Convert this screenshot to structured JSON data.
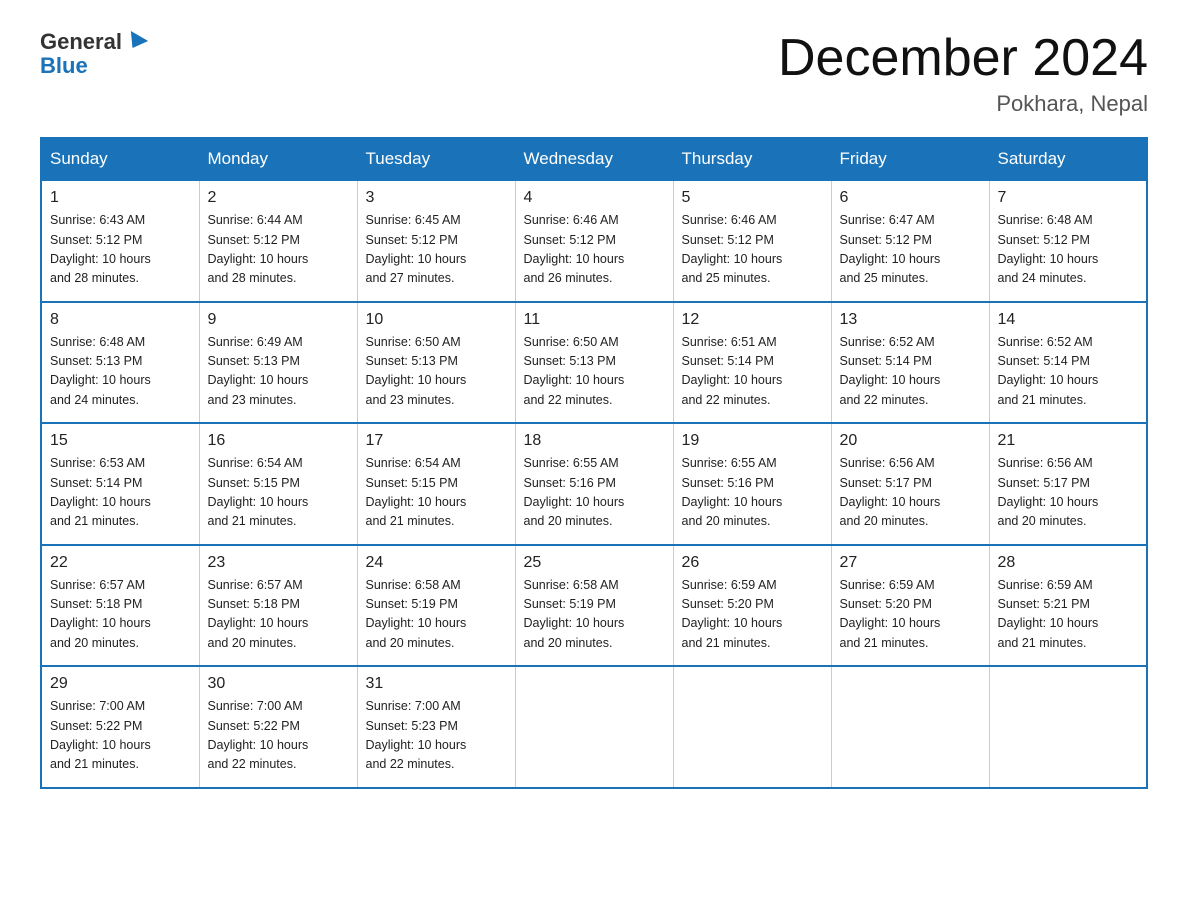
{
  "header": {
    "logo_general": "General",
    "logo_blue": "Blue",
    "month_title": "December 2024",
    "location": "Pokhara, Nepal"
  },
  "days_of_week": [
    "Sunday",
    "Monday",
    "Tuesday",
    "Wednesday",
    "Thursday",
    "Friday",
    "Saturday"
  ],
  "weeks": [
    [
      {
        "num": "1",
        "sunrise": "6:43 AM",
        "sunset": "5:12 PM",
        "daylight": "10 hours and 28 minutes."
      },
      {
        "num": "2",
        "sunrise": "6:44 AM",
        "sunset": "5:12 PM",
        "daylight": "10 hours and 28 minutes."
      },
      {
        "num": "3",
        "sunrise": "6:45 AM",
        "sunset": "5:12 PM",
        "daylight": "10 hours and 27 minutes."
      },
      {
        "num": "4",
        "sunrise": "6:46 AM",
        "sunset": "5:12 PM",
        "daylight": "10 hours and 26 minutes."
      },
      {
        "num": "5",
        "sunrise": "6:46 AM",
        "sunset": "5:12 PM",
        "daylight": "10 hours and 25 minutes."
      },
      {
        "num": "6",
        "sunrise": "6:47 AM",
        "sunset": "5:12 PM",
        "daylight": "10 hours and 25 minutes."
      },
      {
        "num": "7",
        "sunrise": "6:48 AM",
        "sunset": "5:12 PM",
        "daylight": "10 hours and 24 minutes."
      }
    ],
    [
      {
        "num": "8",
        "sunrise": "6:48 AM",
        "sunset": "5:13 PM",
        "daylight": "10 hours and 24 minutes."
      },
      {
        "num": "9",
        "sunrise": "6:49 AM",
        "sunset": "5:13 PM",
        "daylight": "10 hours and 23 minutes."
      },
      {
        "num": "10",
        "sunrise": "6:50 AM",
        "sunset": "5:13 PM",
        "daylight": "10 hours and 23 minutes."
      },
      {
        "num": "11",
        "sunrise": "6:50 AM",
        "sunset": "5:13 PM",
        "daylight": "10 hours and 22 minutes."
      },
      {
        "num": "12",
        "sunrise": "6:51 AM",
        "sunset": "5:14 PM",
        "daylight": "10 hours and 22 minutes."
      },
      {
        "num": "13",
        "sunrise": "6:52 AM",
        "sunset": "5:14 PM",
        "daylight": "10 hours and 22 minutes."
      },
      {
        "num": "14",
        "sunrise": "6:52 AM",
        "sunset": "5:14 PM",
        "daylight": "10 hours and 21 minutes."
      }
    ],
    [
      {
        "num": "15",
        "sunrise": "6:53 AM",
        "sunset": "5:14 PM",
        "daylight": "10 hours and 21 minutes."
      },
      {
        "num": "16",
        "sunrise": "6:54 AM",
        "sunset": "5:15 PM",
        "daylight": "10 hours and 21 minutes."
      },
      {
        "num": "17",
        "sunrise": "6:54 AM",
        "sunset": "5:15 PM",
        "daylight": "10 hours and 21 minutes."
      },
      {
        "num": "18",
        "sunrise": "6:55 AM",
        "sunset": "5:16 PM",
        "daylight": "10 hours and 20 minutes."
      },
      {
        "num": "19",
        "sunrise": "6:55 AM",
        "sunset": "5:16 PM",
        "daylight": "10 hours and 20 minutes."
      },
      {
        "num": "20",
        "sunrise": "6:56 AM",
        "sunset": "5:17 PM",
        "daylight": "10 hours and 20 minutes."
      },
      {
        "num": "21",
        "sunrise": "6:56 AM",
        "sunset": "5:17 PM",
        "daylight": "10 hours and 20 minutes."
      }
    ],
    [
      {
        "num": "22",
        "sunrise": "6:57 AM",
        "sunset": "5:18 PM",
        "daylight": "10 hours and 20 minutes."
      },
      {
        "num": "23",
        "sunrise": "6:57 AM",
        "sunset": "5:18 PM",
        "daylight": "10 hours and 20 minutes."
      },
      {
        "num": "24",
        "sunrise": "6:58 AM",
        "sunset": "5:19 PM",
        "daylight": "10 hours and 20 minutes."
      },
      {
        "num": "25",
        "sunrise": "6:58 AM",
        "sunset": "5:19 PM",
        "daylight": "10 hours and 20 minutes."
      },
      {
        "num": "26",
        "sunrise": "6:59 AM",
        "sunset": "5:20 PM",
        "daylight": "10 hours and 21 minutes."
      },
      {
        "num": "27",
        "sunrise": "6:59 AM",
        "sunset": "5:20 PM",
        "daylight": "10 hours and 21 minutes."
      },
      {
        "num": "28",
        "sunrise": "6:59 AM",
        "sunset": "5:21 PM",
        "daylight": "10 hours and 21 minutes."
      }
    ],
    [
      {
        "num": "29",
        "sunrise": "7:00 AM",
        "sunset": "5:22 PM",
        "daylight": "10 hours and 21 minutes."
      },
      {
        "num": "30",
        "sunrise": "7:00 AM",
        "sunset": "5:22 PM",
        "daylight": "10 hours and 22 minutes."
      },
      {
        "num": "31",
        "sunrise": "7:00 AM",
        "sunset": "5:23 PM",
        "daylight": "10 hours and 22 minutes."
      },
      null,
      null,
      null,
      null
    ]
  ],
  "labels": {
    "sunrise": "Sunrise:",
    "sunset": "Sunset:",
    "daylight": "Daylight:"
  }
}
